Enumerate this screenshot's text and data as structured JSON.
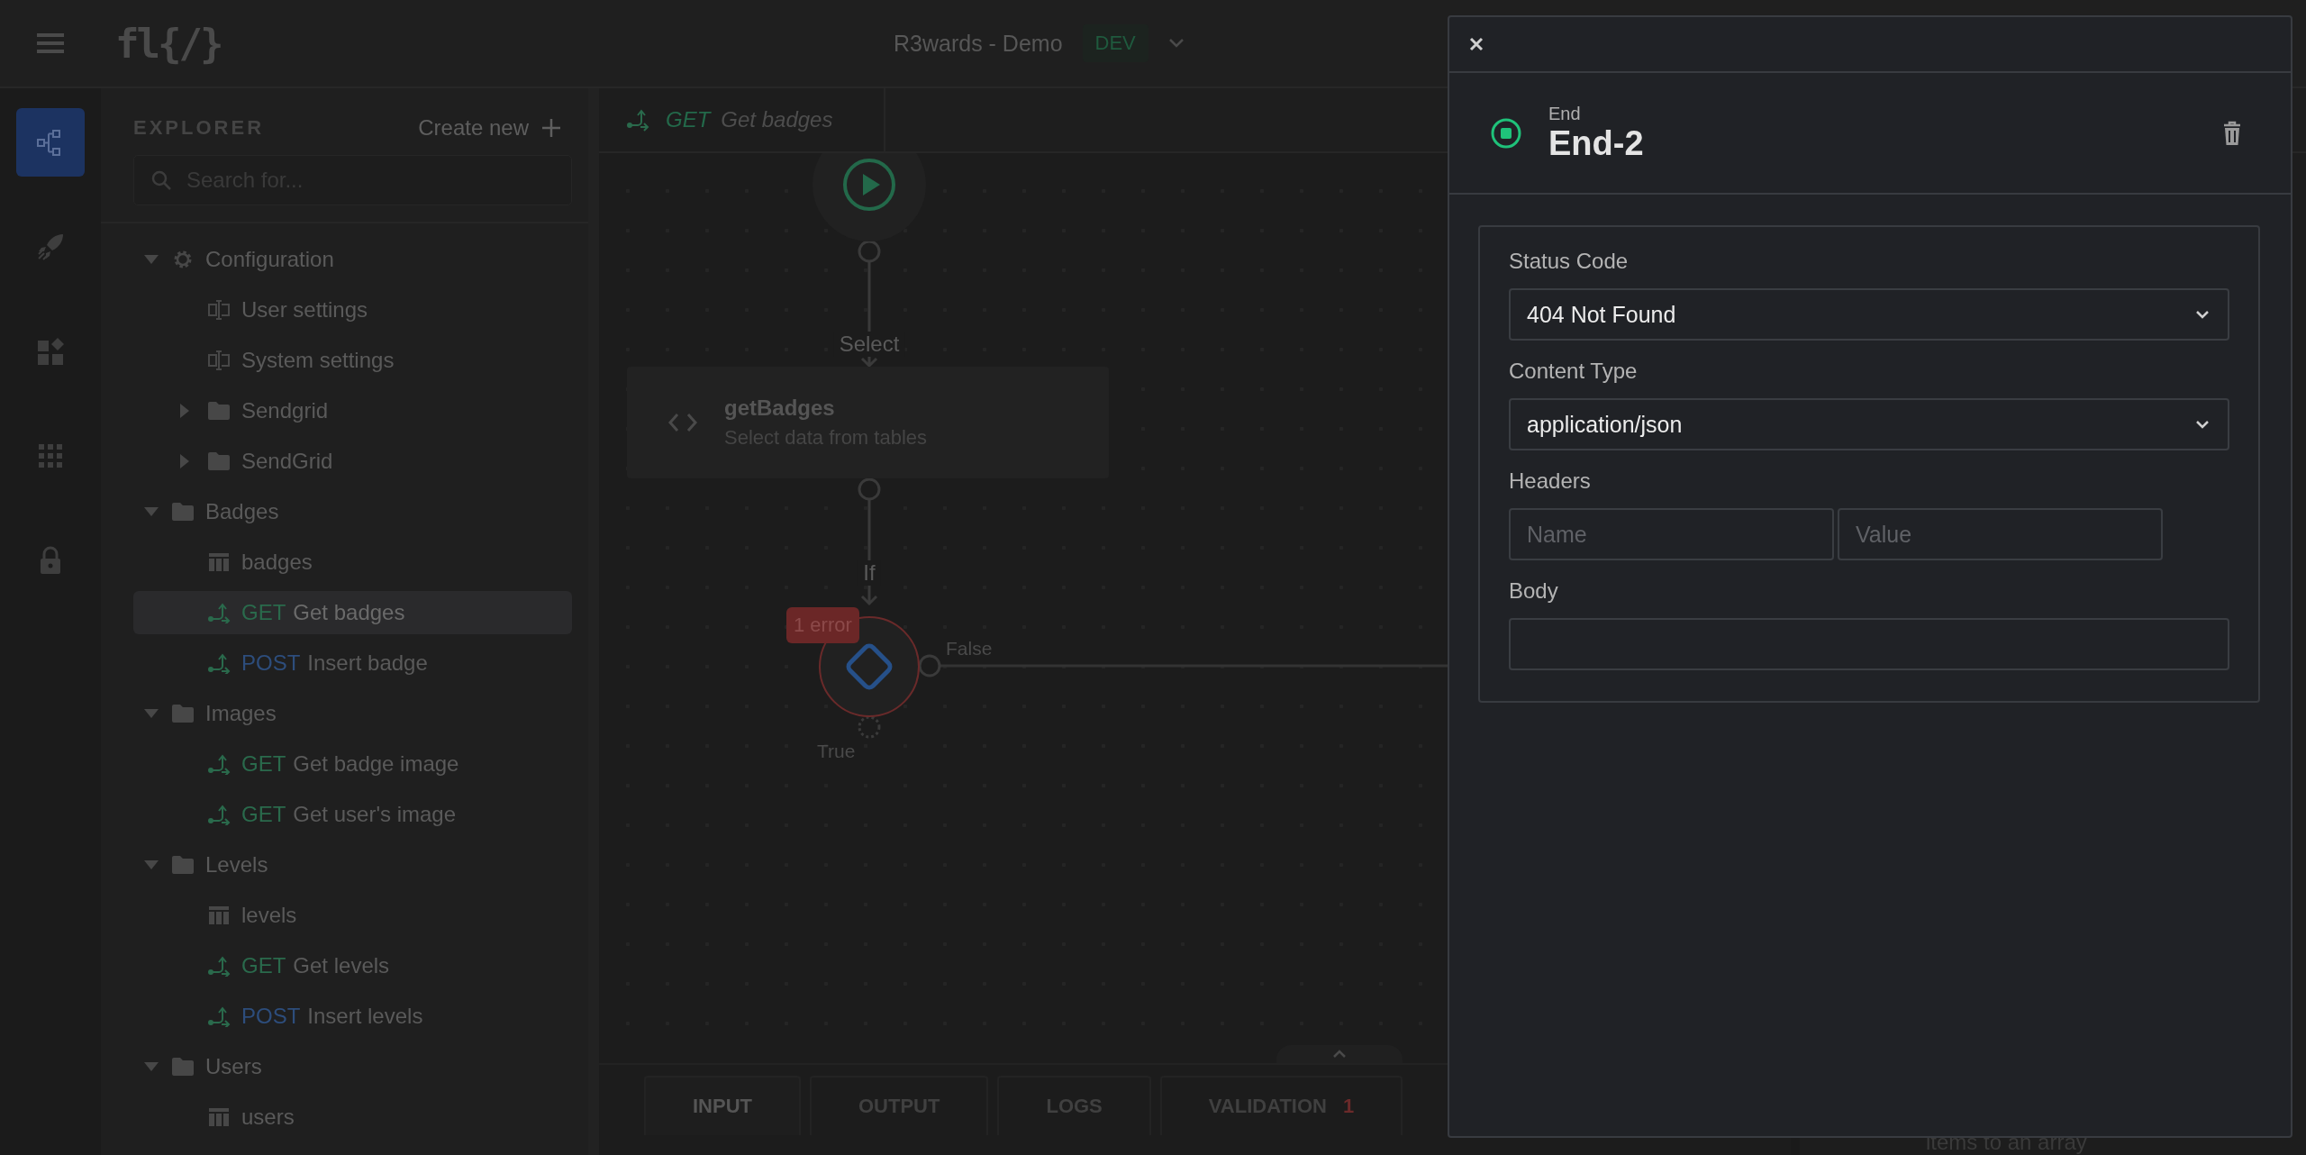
{
  "header": {
    "logo": "fl{/}",
    "app_title": "R3wards - Demo",
    "env_badge": "DEV"
  },
  "rail": [
    {
      "selected": true
    },
    {
      "selected": false
    },
    {
      "selected": false
    },
    {
      "selected": false
    },
    {
      "selected": false
    }
  ],
  "explorer": {
    "title": "EXPLORER",
    "create_label": "Create new",
    "search": {
      "placeholder": "Search for..."
    },
    "tree": [
      {
        "label": "Configuration",
        "kind": "settings-group",
        "expanded": true,
        "selected": false,
        "children": [
          {
            "label": "User settings",
            "kind": "setting",
            "selected": false
          },
          {
            "label": "System settings",
            "kind": "setting",
            "selected": false
          },
          {
            "label": "Sendgrid",
            "kind": "folder",
            "expanded": false,
            "selected": false
          },
          {
            "label": "SendGrid",
            "kind": "folder",
            "expanded": false,
            "selected": false
          }
        ]
      },
      {
        "label": "Badges",
        "kind": "folder",
        "expanded": true,
        "selected": false,
        "children": [
          {
            "label": "badges",
            "kind": "table",
            "selected": false
          },
          {
            "label": "Get badges",
            "kind": "endpoint",
            "method": "GET",
            "color": "#2a6a4c",
            "selected": true
          },
          {
            "label": "Insert badge",
            "kind": "endpoint",
            "method": "POST",
            "color": "#2d4d7c",
            "selected": false
          }
        ]
      },
      {
        "label": "Images",
        "kind": "folder",
        "expanded": true,
        "selected": false,
        "children": [
          {
            "label": "Get badge image",
            "kind": "endpoint",
            "method": "GET",
            "color": "#2a6a4c",
            "selected": false
          },
          {
            "label": "Get user's image",
            "kind": "endpoint",
            "method": "GET",
            "color": "#2a6a4c",
            "selected": false
          }
        ]
      },
      {
        "label": "Levels",
        "kind": "folder",
        "expanded": true,
        "selected": false,
        "children": [
          {
            "label": "levels",
            "kind": "table",
            "selected": false
          },
          {
            "label": "Get levels",
            "kind": "endpoint",
            "method": "GET",
            "color": "#2a6a4c",
            "selected": false
          },
          {
            "label": "Insert levels",
            "kind": "endpoint",
            "method": "POST",
            "color": "#2d4d7c",
            "selected": false
          }
        ]
      },
      {
        "label": "Users",
        "kind": "folder",
        "expanded": true,
        "selected": false,
        "children": [
          {
            "label": "users",
            "kind": "table",
            "selected": false
          }
        ]
      }
    ]
  },
  "editor_tab": {
    "method": "GET",
    "label": "Get badges"
  },
  "canvas": {
    "nodes": [
      {
        "kind": "start"
      },
      {
        "kind": "action",
        "edge_label": "Select",
        "title": "getBadges",
        "subtitle": "Select data from tables"
      },
      {
        "kind": "condition",
        "edge_label": "If",
        "error_badge": "1 error",
        "false_label": "False",
        "true_label": "True"
      }
    ]
  },
  "bottom_panel": {
    "tabs": [
      {
        "label": "INPUT",
        "selected": true
      },
      {
        "label": "OUTPUT",
        "selected": false
      },
      {
        "label": "LOGS",
        "selected": false
      },
      {
        "label": "VALIDATION",
        "count": "1",
        "selected": false
      }
    ]
  },
  "right_panel": {
    "text": "items to an array"
  },
  "drawer": {
    "node_type": "End",
    "node_name": "End-2",
    "fields": [
      {
        "kind": "select",
        "label": "Status Code",
        "value": "404 Not Found"
      },
      {
        "kind": "select",
        "label": "Content Type",
        "value": "application/json"
      },
      {
        "kind": "pair",
        "label": "Headers",
        "inputs": [
          {
            "placeholder": "Name"
          },
          {
            "placeholder": "Value"
          }
        ]
      },
      {
        "kind": "text",
        "label": "Body"
      }
    ]
  }
}
